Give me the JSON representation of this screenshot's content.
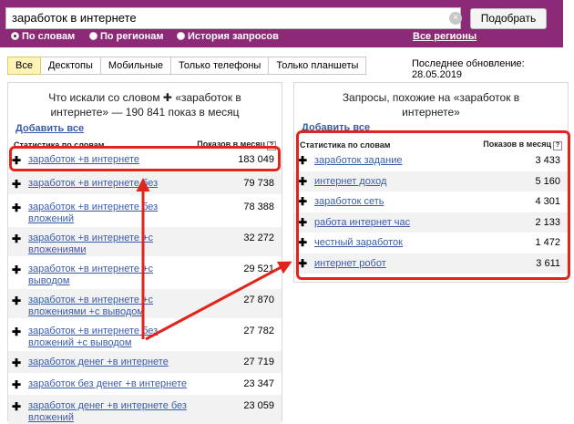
{
  "search": {
    "value": "заработок в интернете",
    "clear_icon": "×",
    "submit_label": "Подобрать"
  },
  "modes": [
    {
      "label": "По словам",
      "selected": true
    },
    {
      "label": "По регионам",
      "selected": false
    },
    {
      "label": "История запросов",
      "selected": false
    }
  ],
  "regions_link": "Все регионы",
  "device_tabs": [
    "Все",
    "Десктопы",
    "Мобильные",
    "Только телефоны",
    "Только планшеты"
  ],
  "last_update": "Последнее обновление: 28.05.2019",
  "left_panel": {
    "title_line1": "Что искали со словом ✚ «заработок в",
    "title_line2": "интернете» — 190 841 показ в месяц",
    "add_all": "Добавить все",
    "col_phrase": "Статистика по словам",
    "col_count": "Показов в месяц",
    "rows": [
      {
        "phrase1": "заработок +в интернете",
        "phrase2": "",
        "count": "183 049"
      },
      {
        "phrase1": "заработок +в интернете без",
        "phrase2": "",
        "count": "79 738"
      },
      {
        "phrase1": "заработок +в интернете без",
        "phrase2": "вложений",
        "count": "78 388"
      },
      {
        "phrase1": "заработок +в интернете +с",
        "phrase2": "вложениями",
        "count": "32 272"
      },
      {
        "phrase1": "заработок +в интернете +с",
        "phrase2": "выводом",
        "count": "29 521"
      },
      {
        "phrase1": "заработок +в интернете +с",
        "phrase2": "вложениями +с выводом",
        "count": "27 870"
      },
      {
        "phrase1": "заработок +в интернете без",
        "phrase2": "вложений +с выводом",
        "count": "27 782"
      },
      {
        "phrase1": "заработок денег +в интернете",
        "phrase2": "",
        "count": "27 719"
      },
      {
        "phrase1": "заработок без денег +в интернете",
        "phrase2": "",
        "count": "23 347"
      },
      {
        "phrase1": "заработок денег +в интернете без",
        "phrase2": "вложений",
        "count": "23 059"
      }
    ]
  },
  "right_panel": {
    "title_line1": "Запросы, похожие на «заработок в",
    "title_line2": "интернете»",
    "add_all": "Добавить все",
    "col_phrase": "Статистика по словам",
    "col_count": "Показов в месяц",
    "rows": [
      {
        "phrase": "заработок задание",
        "count": "3 433"
      },
      {
        "phrase": "интернет доход",
        "count": "5 160"
      },
      {
        "phrase": "заработок сеть",
        "count": "4 301"
      },
      {
        "phrase": "работа интернет час",
        "count": "2 133"
      },
      {
        "phrase": "честный заработок",
        "count": "1 472"
      },
      {
        "phrase": "интернет робот",
        "count": "3 611"
      }
    ]
  },
  "help_icon": "?",
  "plus_icon": "✚",
  "accent_color": "#8d2a78",
  "highlight_color": "#e1241c"
}
